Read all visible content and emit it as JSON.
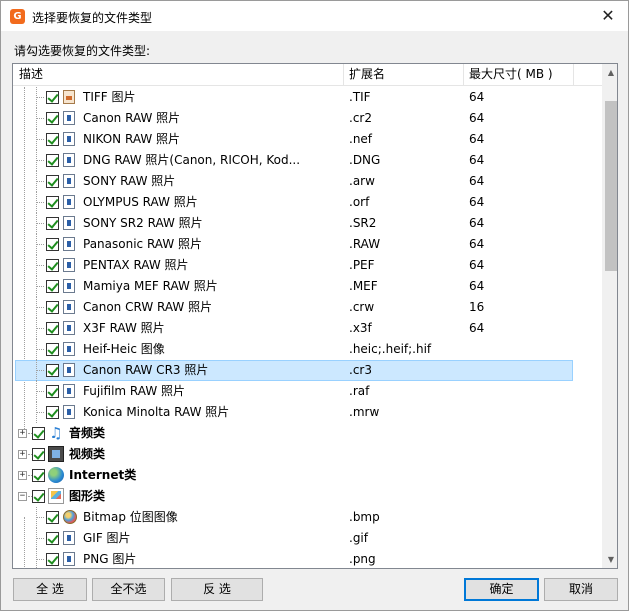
{
  "window": {
    "title": "选择要恢复的文件类型",
    "close": "✕",
    "app_icon_letter": "G"
  },
  "hint": "请勾选要恢复的文件类型:",
  "columns": {
    "desc": "描述",
    "ext": "扩展名",
    "size": "最大尺寸( MB )"
  },
  "rows": [
    {
      "label": "TIFF 图片",
      "ext": ".TIF",
      "size": "64",
      "icon": "tiff-image-icon"
    },
    {
      "label": "Canon RAW 照片",
      "ext": ".cr2",
      "size": "64",
      "icon": "file-icon"
    },
    {
      "label": "NIKON RAW 照片",
      "ext": ".nef",
      "size": "64",
      "icon": "file-icon"
    },
    {
      "label": "DNG RAW 照片(Canon, RICOH, Kod...",
      "ext": ".DNG",
      "size": "64",
      "icon": "file-icon"
    },
    {
      "label": "SONY RAW 照片",
      "ext": ".arw",
      "size": "64",
      "icon": "file-icon"
    },
    {
      "label": "OLYMPUS RAW 照片",
      "ext": ".orf",
      "size": "64",
      "icon": "file-icon"
    },
    {
      "label": "SONY SR2 RAW 照片",
      "ext": ".SR2",
      "size": "64",
      "icon": "file-icon"
    },
    {
      "label": "Panasonic RAW 照片",
      "ext": ".RAW",
      "size": "64",
      "icon": "file-icon"
    },
    {
      "label": "PENTAX RAW 照片",
      "ext": ".PEF",
      "size": "64",
      "icon": "file-icon"
    },
    {
      "label": "Mamiya MEF RAW 照片",
      "ext": ".MEF",
      "size": "64",
      "icon": "file-icon"
    },
    {
      "label": "Canon CRW RAW 照片",
      "ext": ".crw",
      "size": "16",
      "icon": "file-icon"
    },
    {
      "label": "X3F RAW 照片",
      "ext": ".x3f",
      "size": "64",
      "icon": "file-icon"
    },
    {
      "label": "Heif-Heic 图像",
      "ext": ".heic;.heif;.hif",
      "size": "",
      "icon": "file-icon"
    },
    {
      "label": "Canon RAW CR3 照片",
      "ext": ".cr3",
      "size": "",
      "icon": "file-icon",
      "selected": true
    },
    {
      "label": "Fujifilm RAW 照片",
      "ext": ".raf",
      "size": "",
      "icon": "file-icon"
    },
    {
      "label": "Konica Minolta RAW 照片",
      "ext": ".mrw",
      "size": "",
      "icon": "file-icon"
    }
  ],
  "categories": [
    {
      "label": "音频类",
      "expander": "+",
      "icon": "music-note-icon"
    },
    {
      "label": "视频类",
      "expander": "+",
      "icon": "film-icon"
    },
    {
      "label": "Internet类",
      "expander": "+",
      "icon": "globe-icon"
    },
    {
      "label": "图形类",
      "expander": "−",
      "icon": "graphics-icon"
    }
  ],
  "graphics_rows": [
    {
      "label": "Bitmap 位图图像",
      "ext": ".bmp",
      "size": "",
      "icon": "bitmap-icon"
    },
    {
      "label": "GIF 图片",
      "ext": ".gif",
      "size": "",
      "icon": "file-icon"
    },
    {
      "label": "PNG 图片",
      "ext": ".png",
      "size": "",
      "icon": "file-icon"
    }
  ],
  "scrollbar": {
    "up": "▲",
    "down": "▼"
  },
  "buttons": {
    "select_all": "全 选",
    "select_none": "全不选",
    "invert": "反 选",
    "ok": "确定",
    "cancel": "取消"
  }
}
